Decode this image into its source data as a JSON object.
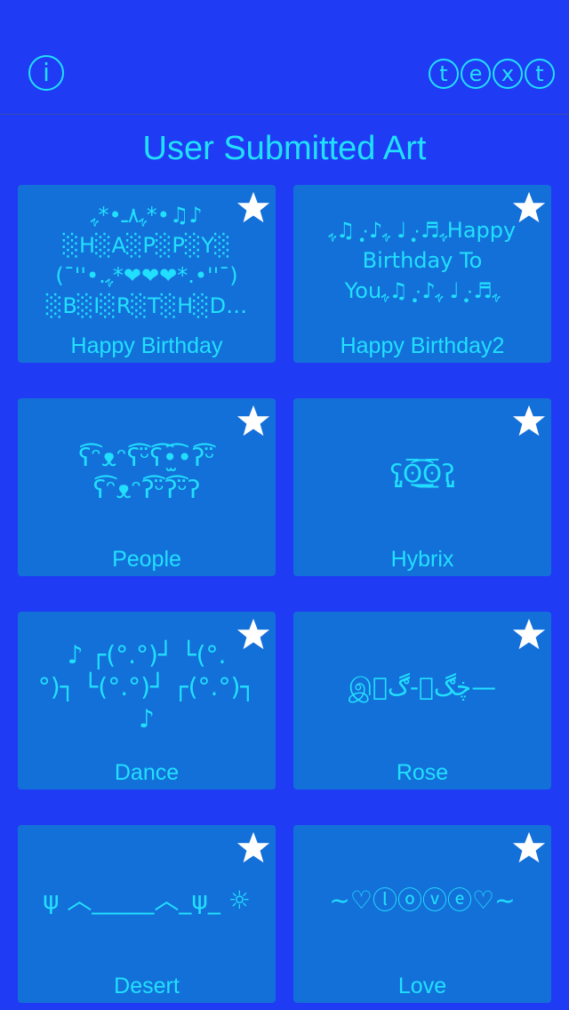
{
  "nav": {
    "info_icon_glyph": "i",
    "logo_letters": [
      "t",
      "e",
      "x",
      "t"
    ]
  },
  "page_title": "User Submitted Art",
  "cards": [
    {
      "label": "Happy Birthday",
      "art": "ﮩ٨ـ•*ﮩ*•♫♪\n░H░A░P░P░Y░\n(¯''•.ﮩ*❤❤❤*.•''¯)\n░B░I░R░T░H░D…",
      "favorite_icon": "star-icon"
    },
    {
      "label": "Happy Birthday2",
      "art": "ﮩ♬·̩̩̥͙ ♩ ﮩ♪·̩̩̥͙ ♫ﮩHappy\nBirthday To\nYouﮩ♬·̩̩̥͙ ♩ ﮩ♪·̩̩̥͙ ♫ﮩ",
      "favorite_icon": "star-icon"
    },
    {
      "label": "People",
      "art": "ʕ͡ᵔᴥᵔʕ͡ᵕ̈ʕ͡•̫͡•ʔ͡ᵕ̈\nʕ͡ᵔᴥᵔʔ͡ᵕ̈ʔ͡ᵕ̈ʔ",
      "favorite_icon": "star-icon"
    },
    {
      "label": "Hybrix",
      "art": "ʕ̡̢̡ʘ̅͟͜͡ʘ̲̅ʔ̢̡̢",
      "favorite_icon": "star-icon"
    },
    {
      "label": "Dance",
      "art": "♪ ┌(°.°)┘ └(°.\n°)┐ └(°.°)┘ ┌(°.°)┐\n♪",
      "favorite_icon": "star-icon"
    },
    {
      "label": "Rose",
      "art": "இڿڰۣ-ڰۣ—",
      "favorite_icon": "star-icon"
    },
    {
      "label": "Desert",
      "art": "ψ ︿_____︿_ψ_ ☼",
      "favorite_icon": "star-icon"
    },
    {
      "label": "Love",
      "art": "~♡ⓛⓞⓥⓔ♡~",
      "favorite_icon": "star-icon"
    }
  ]
}
